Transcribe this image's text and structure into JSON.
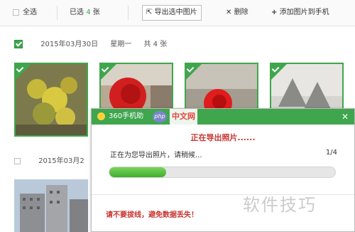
{
  "toolbar": {
    "select_all_label": "全选",
    "selected_prefix": "已选",
    "selected_count": "4",
    "selected_suffix": "张",
    "export_label": "导出选中图片",
    "delete_label": "删除",
    "add_label": "添加图片到手机"
  },
  "groups": [
    {
      "date": "2015年03月30日",
      "weekday": "星期一",
      "total_label": "共 4 张"
    },
    {
      "date": "2015年03月2"
    }
  ],
  "dialog": {
    "title": "360手机助",
    "site_badge": "php",
    "site_text": "中文网",
    "heading": "正在导出照片......",
    "status": "正在为您导出照片，请稍候...",
    "count": "1/4",
    "progress_fraction": 0.25,
    "warning": "请不要拔线，避免数据丢失！",
    "close_symbol": "✕"
  },
  "watermark": "软件技巧",
  "colors": {
    "accent": "#3fa64d",
    "warning": "#c9332f"
  }
}
